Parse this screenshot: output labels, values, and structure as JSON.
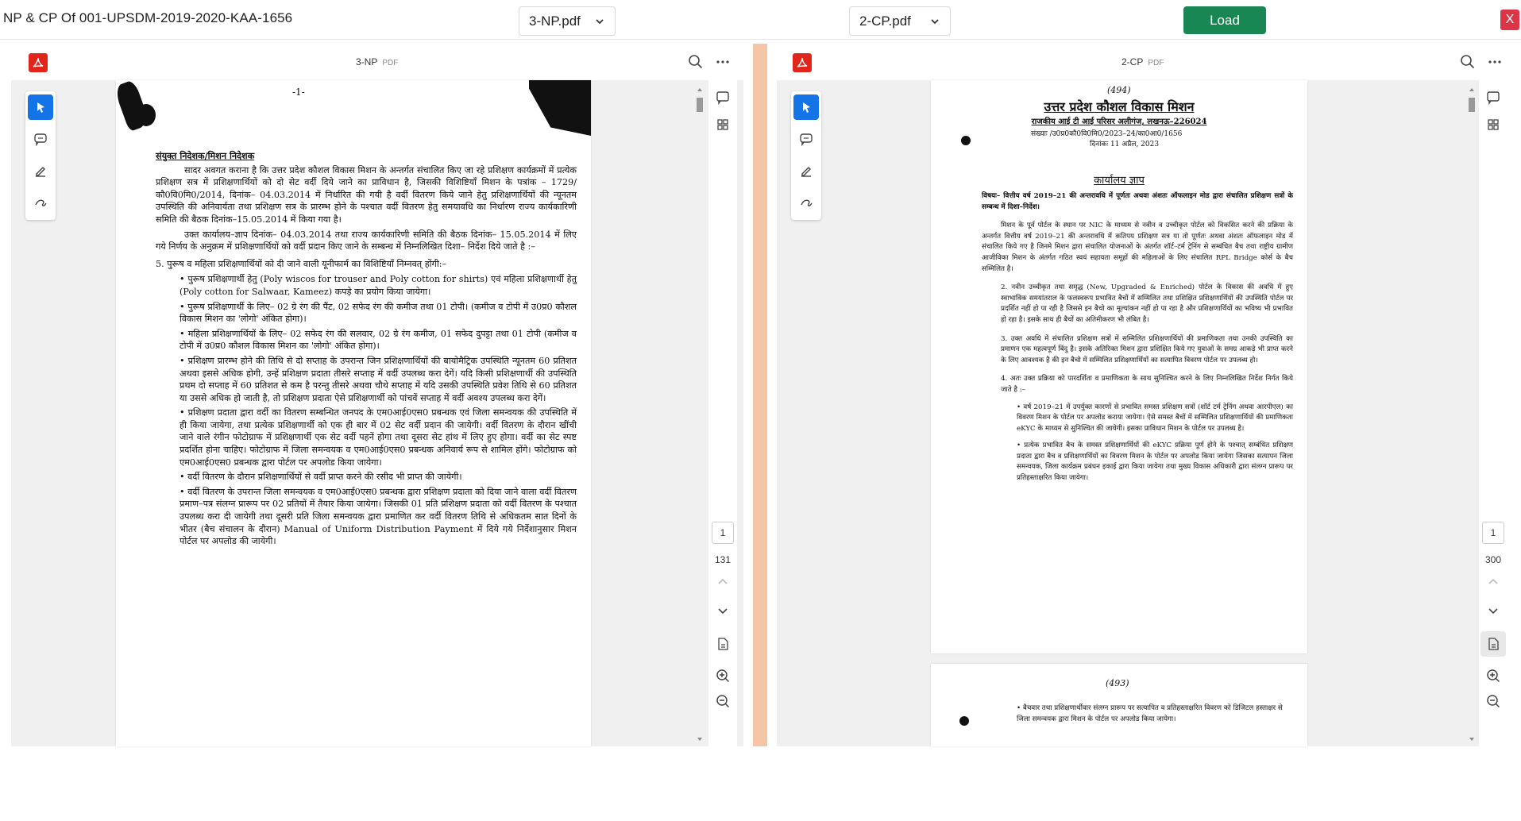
{
  "header": {
    "title": "NP & CP Of 001-UPSDM-2019-2020-KAA-1656",
    "left_select": "3-NP.pdf",
    "right_select": "2-CP.pdf",
    "load_label": "Load",
    "close_label": "X"
  },
  "left_viewer": {
    "doc_name": "3-NP",
    "doc_ext": "PDF",
    "current_page": "1",
    "total_pages": "131",
    "page": {
      "header_mark": "-1-",
      "salutation": "संयुक्त निदेशक/मिशन निदेशक",
      "para1": "सादर अवगत कराना है कि उत्तर प्रदेश कौशल विकास मिशन के अन्तर्गत संचालित किए जा रहे प्रशिक्षण कार्यक्रमों में प्रत्येक प्रशिक्षण सत्र में प्रशिक्षणार्थियों को दो सेट वर्दी दिये जाने का प्राविधान है, जिसकी विशिष्टियाँ मिशन के पत्रांक – 1729/कौ0वि0मि0/2014, दिनांक– 04.03.2014 में निर्धारित की गयी है वर्दी वितरण किये जाने हेतु प्रशिक्षणार्थियों की न्यूनतम उपस्थिति की अनिवार्यता तथा प्रशिक्षण सत्र के प्रारम्भ होने के पश्चात वर्दी वितरण हेतु समयावधि का निर्धारण राज्य कार्यकारिणी समिति की बैठक दिनांक–15.05.2014 में किया गया है।",
      "para2": "उक्त कार्यालय–ज्ञाप दिनांक– 04.03.2014 तथा राज्य कार्यकारिणी समिति की बैठक दिनांक– 15.05.2014 में लिए गये निर्णय के अनुक्रम में प्रशिक्षणार्थियों को वर्दी प्रदान किए जाने के सम्बन्ध में निम्नलिखित दिशा– निर्देश दिये जाते है :–",
      "item5": "5. पुरूष व महिला प्रशिक्षणार्थियों को दी जाने वाली यूनीफार्म का विशिष्टियाँ निम्नवत् होंगी:–",
      "bullets": [
        "पुरूष प्रशिक्षणार्थी हेतु (Poly wiscos for trouser and Poly cotton for shirts) एवं महिला प्रशिक्षणार्थी हेतु (Poly cotton for Salwaar, Kameez) कपड़े का प्रयोग किया जायेगा।",
        "पुरूष प्रशिक्षणार्थी के लिए– 02 ग्रे रंग की पैंट, 02 सफेद रंग की कमीज तथा 01 टोपी। (कमीज व टोपी में उ0प्र0 कौशल विकास मिशन का 'लोगो' अंकित होगा)।",
        "महिला प्रशिक्षणार्थियों के लिए– 02 सफेद रंग की सलवार, 02 ग्रे रंग कमीज, 01 सफेद दुपट्टा तथा 01 टोपी (कमीज व टोपी में उ0प्र0 कौशल विकास मिशन का 'लोगो' अंकित होगा)।",
        "प्रशिक्षण प्रारम्भ होने की तिथि से दो सप्ताह के उपरान्त जिन प्रशिक्षणार्थियों की बायोमैट्रिक उपस्थिति न्यूनतम 60 प्रतिशत अथवा इससे अधिक होगी, उन्हें प्रशिक्षण प्रदाता तीसरे सप्ताह में वर्दी उपलब्ध करा देगें। यदि किसी प्रशिक्षणार्थी की उपस्थिति प्रथम दो सप्ताह में 60 प्रतिशत से कम है परन्तु तीसरे अथवा चौथे सप्ताह में यदि उसकी उपस्थिति प्रवेश तिथि से 60 प्रतिशत या उससे अधिक हो जाती है, तो प्रशिक्षण प्रदाता ऐसे प्रशिक्षणार्थी को पांचवें सप्ताह में वर्दी अवश्य उपलब्ध करा देगें।",
        "प्रशिक्षण प्रदाता द्वारा वर्दी का वितरण सम्बन्धित जनपद के एम0आई0एस0 प्रबन्धक एवं जिला समन्वयक की उपस्थिति में ही किया जायेगा, तथा प्रत्येक प्रशिक्षणार्थी को एक ही बार में 02 सेट वर्दी प्रदान की जायेगी। वर्दी वितरण के दौरान खींची जाने वाले रंगीन फोटोग्राफ में प्रशिक्षणार्थी एक सेट वर्दी पहनें होगा तथा दूसरा सेट हांथ में लिए हुए होगा। वर्दी का सेट स्पष्ट प्रदर्शित होना चाहिए। फोटोग्राफ में जिला समन्वयक व एम0आई0एस0 प्रबन्धक अनिवार्य रूप से शामिल होंगे। फोटोग्राफ को एम0आई0एस0 प्रबन्धक द्वारा पोर्टल पर अपलोड किया जायेगा।",
        "वर्दी वितरण के दौरान प्रशिक्षणार्थियों से वर्दी प्राप्त करने की रसीद भी प्राप्त की जायेगी।",
        "वर्दी वितरण के उपरान्त जिला समन्वयक व एम0आई0एस0 प्रबन्धक द्वारा प्रशिक्षण प्रदाता को दिया जाने वाला वर्दी वितरण प्रमाण–पत्र संलग्न प्रारूप पर 02 प्रतियों में तैयार किया जायेगा। जिसकी 01 प्रति प्रशिक्षण प्रदाता को वर्दी वितरण के पश्चात उपलब्ध करा दी जायेगी तथा दूसरी प्रति जिला समन्वयक द्वारा प्रमाणित कर वर्दी वितरण तिथि से अधिकतम सात दिनों के भीतर (बैच संचालन के दौरान) Manual of Uniform Distribution Payment में दिये गये निर्देशानुसार मिशन पोर्टल पर अपलोड की जायेगी।"
      ]
    }
  },
  "right_viewer": {
    "doc_name": "2-CP",
    "doc_ext": "PDF",
    "current_page": "1",
    "total_pages": "300",
    "page": {
      "page_mark": "(494)",
      "org_title": "उत्तर प्रदेश कौशल विकास मिशन",
      "org_address": "राजकीय आई टी आई परिसर अलीगंज, लखनऊ–226024",
      "ref_line": "संख्याः   /उ0प्र0कौ0वि0मि0/2023–24/का0आ0/1656",
      "date_line": "दिनांकः 11 अप्रैल, 2023",
      "heading": "कार्यालय ज्ञाप",
      "subject": "विषयः– वित्तीय वर्ष 2019–21 की अन्तरावधि में पूर्णतः अथवा अंशतः ऑफलाइन मोड द्वारा संचालित प्रशिक्षण सत्रों के सम्बन्ध में दिशा–निर्देश।",
      "para1": "मिशन के पूर्व पोर्टल के स्थान पर NIC के माध्यम से नवीन व उच्चीकृत पोर्टल को विकसित करने की प्रक्रिया के अन्तर्गत वित्तीय वर्ष 2019–21 की अन्तरावधि में कतिपय प्रशिक्षण सत्र या तो पूर्णतः अथवा अंशतः ऑफलाइन मोड में संचालित किये गए है जिनमे मिशन द्वारा संचालित योजनाओं के अंतर्गत शॉर्ट–टर्म ट्रेनिंग से सम्बंधित बैच तथा राष्ट्रीय ग्रामीण आजीविका मिशन के अंतर्गत गठित स्वयं सहायता समूहों की महिलाओं के लिए संचालित RPL Bridge कोर्स के बैच सम्मिलित है।",
      "para2": "2. नवीन उच्चीकृत तथा समृद्ध (New, Upgraded & Enriched) पोर्टल के विकास की अवधि में हुए स्वाभाविक समयांतराल के फलस्वरूप प्रभावित बैचों में सम्मिलित तथा प्रशिक्षित प्रशिक्षणार्थियों की उपस्थिति पोर्टल पर प्रदर्शित नहीं हो पा रही है जिससे इन बैचो का मूल्यांकन नहीं हो पा रहा है और प्रशिक्षणार्थियों का भविष्य भी प्रभावित हो रहा है। इसके साथ ही बैचों का अतिमीकरण भी लंबित है।",
      "para3": "3. उक्त अवधि में संचालित प्रशिक्षण सत्रों में सम्मिलित प्रशिक्षणार्थियों की प्रमाणिकता तथा उनकी उपस्थिति का प्रमाणन एक महत्वपूर्ण बिंदु है। इसके अतिरिक्त मिशन द्वारा प्रशिक्षित किये गए युवाओं के समग्र आकड़े भी प्राप्त करने के लिए आवश्यक है की इन बैचो में सम्मिलित प्रशिक्षणार्थियों का सत्यापित विवरण पोर्टल पर उपलब्ध हो।",
      "para4": "4. अतः उक्त प्रक्रिया को पारदर्शिता व प्रमाणिकता के साथ सुनिश्चित करने के लिए निम्नलिखित निर्देश निर्गत किये जाते है :–",
      "bullets": [
        "वर्ष 2019–21 में उपर्युक्त कारणों से प्रभावित समस्त प्रशिक्षण सत्रों (शॉर्ट टर्म ट्रेनिंग अथवा आरपीएल) का विवरण मिशन के पोर्टल पर अपलोड कराया जायेगा। ऐसे समस्त बैचों में सम्मिलित प्रशिक्षणार्थियों की प्रमाणिकता eKYC के माध्यम से सुनिश्चित की जायेगी। इसका प्राविधान मिशन के पोर्टल पर उपलब्ध है।",
        "प्रत्येक प्रभावित बैच के समस्त प्रशिक्षणार्थियों की eKYC प्रक्रिया पूर्ण होने के पश्चात् सम्बंधित प्रशिक्षण प्रदाता द्वारा बैच व प्रशिक्षणार्थियों का विवरण मिशन के पोर्टल पर अपलोड किया जायेगा जिसका सत्यापन जिला समन्वयक, जिला कार्यक्रम प्रबंधन इकाई द्वारा किया जायेगा तथा मुख्य विकास अधिकारी द्वारा संलग्न प्रारूप पर प्रतिहस्ताक्षरित किया जायेगा।"
      ],
      "page2_mark": "(493)",
      "page2_bullet": "बैचवार तथा प्रशिक्षणार्थीवार संलग्न प्रारूप पर सत्यापित व प्रतिहस्ताक्षरित विवरण को डिजिटल हस्ताक्षर से जिला समन्वयक द्वारा मिशन के पोर्टल पर अपलोड किया जायेगा।"
    }
  },
  "icons": {
    "search": "search-icon",
    "more": "more-icon",
    "select": "select-tool-icon",
    "comment": "comment-icon",
    "highlight": "highlight-icon",
    "draw": "draw-icon",
    "thumbnails": "grid-icon",
    "zoom_in": "zoom-in-icon",
    "zoom_out": "zoom-out-icon",
    "chevron_up": "chevron-up-icon",
    "chevron_down": "chevron-down-icon"
  },
  "colors": {
    "load": "#198754",
    "close": "#dc3545",
    "acrobat": "#e1251b",
    "active_tool": "#1473e6",
    "divider": "#f5c6a5"
  }
}
